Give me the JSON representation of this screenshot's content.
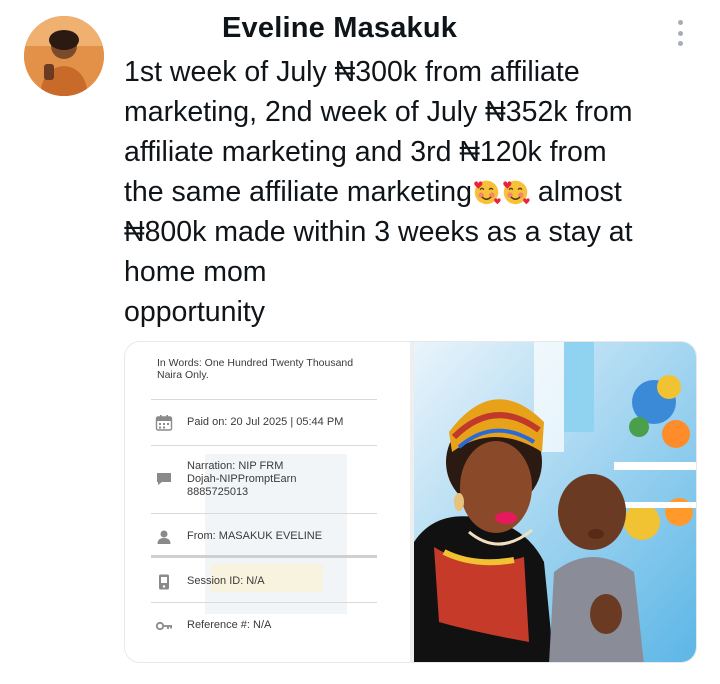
{
  "post": {
    "author_name": "Eveline Masakuk",
    "text_lines": [
      "1st week of July ₦300k from affiliate",
      "marketing, 2nd week of July ₦352k from",
      "affiliate marketing and 3rd ₦120k from",
      "the same affiliate marketing",
      " almost",
      "₦800k made within 3 weeks as a stay at",
      "home mom",
      "opportunity"
    ],
    "emoji_name": "smiling-face-with-hearts"
  },
  "receipt": {
    "in_words": "In Words: One Hundred Twenty Thousand Naira Only.",
    "paid_on": "Paid on: 20 Jul 2025 | 05:44 PM",
    "narration": "Narration: NIP FRM\nDojah-NIPPromptEarn\n8885725013",
    "from": "From: MASAKUK EVELINE",
    "session_id": "Session ID: N/A",
    "reference": "Reference #: N/A"
  },
  "colors": {
    "text": "#0f1419",
    "muted_icon": "#a7adb3",
    "receipt_text": "#3a3a3a"
  },
  "icons": [
    "more-vertical-icon",
    "calendar-icon",
    "chat-icon",
    "user-icon",
    "phone-icon",
    "key-icon"
  ]
}
